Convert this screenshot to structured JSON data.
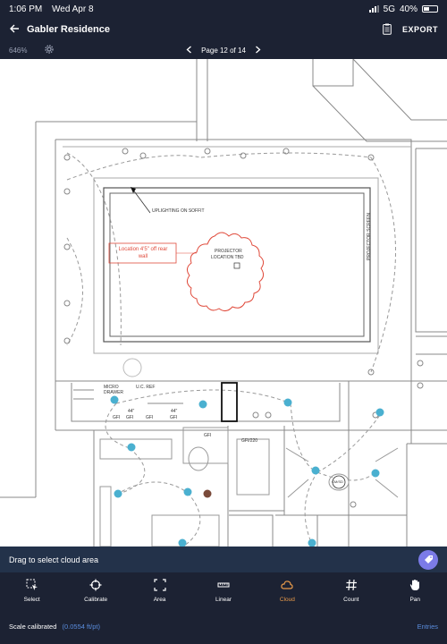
{
  "status": {
    "time": "1:06 PM",
    "date": "Wed Apr 8",
    "network": "5G",
    "battery": "40%"
  },
  "nav": {
    "title": "Gabler Residence",
    "export_label": "EXPORT"
  },
  "view": {
    "zoom": "646%",
    "page_label": "Page 12 of 14"
  },
  "plan": {
    "uplighting": "UPLIGHTING ON SOFFIT",
    "projector_line1": "PROJECTOR",
    "projector_line2": "LOCATION TBD",
    "projector_screen": "PROJECTOR SCREEN",
    "note_line1": "Location 4'5\" off rear",
    "note_line2": "wall",
    "micro_1": "MICRO",
    "micro_2": "DRAWER",
    "uc_ref": "U.C. REF",
    "gfi_44_1": "44\"",
    "gfi_44_2": "44\"",
    "gfi": "GFI",
    "gfi220": "GFI/220",
    "cm": "CM/SD"
  },
  "hint": {
    "text": "Drag to select cloud area"
  },
  "tools": [
    {
      "label": "Select",
      "icon": "select-icon"
    },
    {
      "label": "Calibrate",
      "icon": "crosshair-icon"
    },
    {
      "label": "Area",
      "icon": "area-icon"
    },
    {
      "label": "Linear",
      "icon": "linear-icon"
    },
    {
      "label": "Cloud",
      "icon": "cloud-icon",
      "active": true
    },
    {
      "label": "Count",
      "icon": "hash-icon"
    },
    {
      "label": "Pan",
      "icon": "hand-icon"
    }
  ],
  "footer": {
    "scale_label": "Scale calibrated",
    "scale_value": "(0.0554 ft/pt)",
    "entries_label": "Entries"
  },
  "colors": {
    "accent": "#e89a4a",
    "markup": "#e04b3c",
    "count_dot": "#4ab0d0",
    "link": "#5a8dde",
    "tag_button": "#7b7be8"
  }
}
